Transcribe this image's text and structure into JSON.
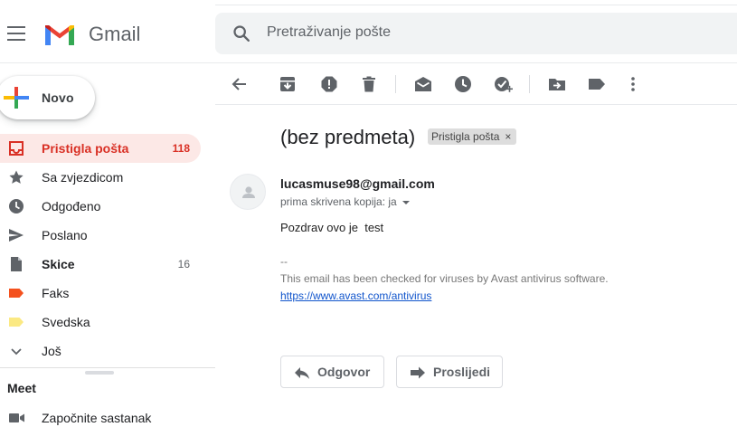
{
  "header": {
    "brand": "Gmail",
    "search_placeholder": "Pretraživanje pošte"
  },
  "compose": {
    "label": "Novo"
  },
  "nav": [
    {
      "label": "Pristigla pošta",
      "count": "118",
      "icon": "inbox-icon",
      "active": true
    },
    {
      "label": "Sa zvjezdicom",
      "count": "",
      "icon": "star-icon"
    },
    {
      "label": "Odgođeno",
      "count": "",
      "icon": "clock-icon"
    },
    {
      "label": "Poslano",
      "count": "",
      "icon": "send-icon"
    },
    {
      "label": "Skice",
      "count": "16",
      "icon": "draft-icon",
      "bold": true
    },
    {
      "label": "Faks",
      "count": "",
      "icon": "label-icon",
      "color": "#f4511e"
    },
    {
      "label": "Svedska",
      "count": "",
      "icon": "label-icon",
      "color": "#fbe983"
    },
    {
      "label": "Još",
      "count": "",
      "icon": "chevron-down-icon"
    }
  ],
  "meet": {
    "title": "Meet",
    "start_label": "Započnite sastanak"
  },
  "toolbar_icons": [
    "back-arrow-icon",
    "archive-icon",
    "report-spam-icon",
    "delete-icon",
    "mark-unread-icon",
    "snooze-icon",
    "add-task-icon",
    "move-to-icon",
    "labels-icon",
    "more-icon"
  ],
  "message": {
    "subject": "(bez predmeta)",
    "label_chip": "Pristigla pošta",
    "label_chip_close": "×",
    "sender": "lucasmuse98@gmail.com",
    "recipient": "prima skrivena kopija: ja",
    "body": "Pozdrav ovo je  test",
    "signature_dash": "--",
    "signature_text": "This email has been checked for viruses by Avast antivirus software.",
    "signature_link": "https://www.avast.com/antivirus"
  },
  "actions": {
    "reply_label": "Odgovor",
    "forward_label": "Proslijedi"
  },
  "colors": {
    "accent_red": "#d93025",
    "active_bg": "#fce8e6",
    "link": "#1155cc"
  }
}
